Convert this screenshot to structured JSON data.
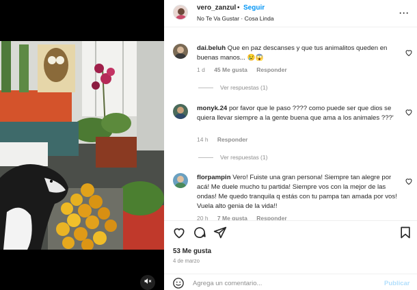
{
  "post": {
    "username": "vero_zanzul",
    "separator": "•",
    "follow_label": "Seguir",
    "audio_line": "No Te Va Gustar · Cosa Linda",
    "more_label": "···"
  },
  "media": {
    "mute_icon": "speaker-muted-icon"
  },
  "comments": [
    {
      "user": "dai.beluh",
      "text": "Que en paz descanses y que tus animalitos queden en buenas manos... 😢😱",
      "time": "1 d",
      "likes": "45 Me gusta",
      "reply": "Responder",
      "view_replies": "Ver respuestas (1)",
      "avatar_color": "#7a6a55"
    },
    {
      "user": "monyk.24",
      "text": "por favor que le paso ???? como puede ser que dios se quiera llevar siempre a la gente buena que ama a los animales ???'",
      "time": "14 h",
      "reply": "Responder",
      "view_replies": "Ver respuestas (1)",
      "avatar_color": "#4a6a5a"
    },
    {
      "user": "florpampin",
      "text": "Vero! Fuiste una gran persona! Siempre tan alegre por acá! Me duele mucho tu partida! Siempre vos con la mejor de las ondas! Me quedo tranquila q estás con tu pampa tan amada por vos! Vuela alto genia de la vida!!",
      "time": "20 h",
      "likes": "7 Me gusta",
      "reply": "Responder",
      "avatar_color": "#6aa0c0"
    }
  ],
  "actions": {
    "like_icon": "heart-icon",
    "comment_icon": "comment-icon",
    "share_icon": "send-icon",
    "save_icon": "bookmark-icon"
  },
  "likes_text": "53 Me gusta",
  "date_text": "4 de marzo",
  "comment_box": {
    "placeholder": "Agrega un comentario...",
    "publish_label": "Publicar"
  },
  "colors": {
    "accent": "#0095f6",
    "publish_disabled": "#b2dffc",
    "muted_text": "#8e8e8e"
  }
}
